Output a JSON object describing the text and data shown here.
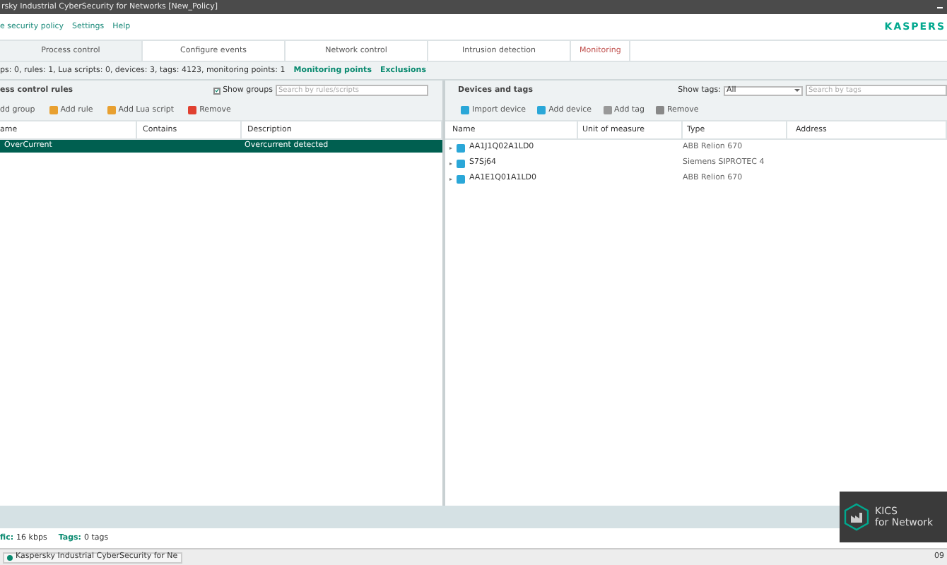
{
  "window": {
    "title": "rsky Industrial CyberSecurity for Networks  [New_Policy]"
  },
  "menu": [
    "e security policy",
    "Settings",
    "Help"
  ],
  "logo": "KASPERS",
  "tabs": [
    {
      "label": "Process control",
      "selected": true,
      "kind": "normal"
    },
    {
      "label": "Configure events",
      "selected": false,
      "kind": "normal"
    },
    {
      "label": "Network control",
      "selected": false,
      "kind": "normal"
    },
    {
      "label": "Intrusion detection",
      "selected": false,
      "kind": "normal"
    },
    {
      "label": "Monitoring",
      "selected": false,
      "kind": "accent"
    }
  ],
  "summary": {
    "text": "ps: 0, rules: 1, Lua scripts: 0, devices: 3, tags: 4123, monitoring points: 1",
    "links": [
      "Monitoring points",
      "Exclusions"
    ]
  },
  "rules_panel": {
    "title": "ess control rules",
    "show_groups": {
      "label": "Show groups",
      "checked": true
    },
    "search": {
      "placeholder": "Search by rules/scripts"
    },
    "toolbar": [
      "dd group",
      "Add rule",
      "Add Lua script",
      "Remove"
    ],
    "columns": [
      "ame",
      "Contains",
      "Description"
    ],
    "rows": [
      {
        "name": "OverCurrent",
        "contains": "",
        "description": "Overcurrent detected",
        "selected": true
      }
    ]
  },
  "devices_panel": {
    "title": "Devices and tags",
    "show_tags": {
      "label": "Show tags:",
      "value": "All"
    },
    "search": {
      "placeholder": "Search by tags"
    },
    "toolbar": [
      "Import device",
      "Add device",
      "Add tag",
      "Remove"
    ],
    "columns": [
      "Name",
      "Unit of measure",
      "Type",
      "Address"
    ],
    "rows": [
      {
        "name": "AA1J1Q02A1LD0",
        "type": "ABB Relion 670",
        "expanded": false
      },
      {
        "name": "S7Sj64",
        "type": "Siemens SIPROTEC 4",
        "expanded": false
      },
      {
        "name": "AA1E1Q01A1LD0",
        "type": "ABB Relion 670",
        "expanded": false
      }
    ]
  },
  "status_bar": [
    {
      "label": "fic:",
      "value": "16 kbps"
    },
    {
      "label": "Tags:",
      "value": "0 tags"
    }
  ],
  "overlay": {
    "line1": "KICS",
    "line2": "for Network"
  },
  "taskbar": {
    "app": "Kaspersky Industrial CyberSecurity for Ne",
    "clock": "09"
  }
}
